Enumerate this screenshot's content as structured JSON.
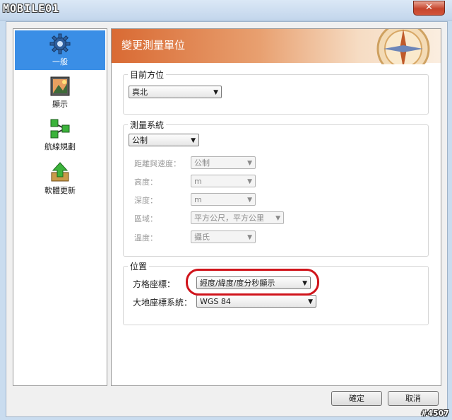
{
  "window": {
    "brand": "MOBILE01",
    "close_symbol": "✕"
  },
  "sidebar": {
    "items": [
      {
        "label": "一般",
        "icon": "gear-icon",
        "active": true
      },
      {
        "label": "顯示",
        "icon": "display-picture-icon",
        "active": false
      },
      {
        "label": "航線規劃",
        "icon": "route-flowchart-icon",
        "active": false
      },
      {
        "label": "軟體更新",
        "icon": "software-update-arrow-icon",
        "active": false
      }
    ]
  },
  "main": {
    "title": "變更測量單位",
    "orientation_group": {
      "title": "目前方位",
      "value": "真北"
    },
    "measurement_group": {
      "title": "測量系統",
      "value": "公制",
      "rows": [
        {
          "label": "距離與速度：",
          "value": "公制"
        },
        {
          "label": "高度：",
          "value": "m"
        },
        {
          "label": "深度：",
          "value": "m"
        },
        {
          "label": "區域：",
          "value": "平方公尺，平方公里"
        },
        {
          "label": "溫度：",
          "value": "攝氏"
        }
      ]
    },
    "position_group": {
      "title": "位置",
      "rows": [
        {
          "label": "方格座標：",
          "value": "經度/緯度/度分秒顯示"
        },
        {
          "label": "大地座標系統：",
          "value": "WGS 84"
        }
      ]
    }
  },
  "footer": {
    "ok_label": "確定",
    "cancel_label": "取消"
  },
  "watermark": "#4507",
  "colors": {
    "sidebar_active": "#3a8ee6",
    "banner": "#d96a33",
    "highlight_ring": "#d0141b"
  }
}
